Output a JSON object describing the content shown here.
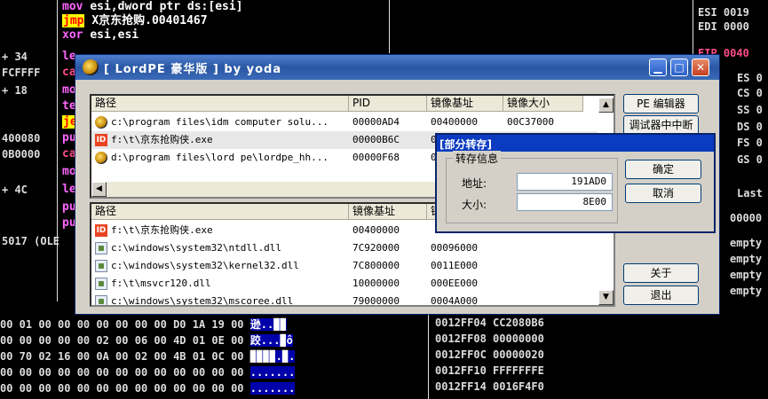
{
  "debugger": {
    "asm_lines": [
      {
        "mnemonic": "mov",
        "operand": "esi,dword ptr ds:[esi]"
      },
      {
        "mnemonic": "jmp",
        "operand": "X京东抢购.00401467"
      },
      {
        "mnemonic": "xor",
        "operand": "esi,esi"
      }
    ],
    "asm_partial_left": [
      "le",
      "ca",
      "mo",
      "te",
      "je",
      "pu",
      "ca",
      "mo",
      "le",
      "pu",
      "pu"
    ],
    "left_values": [
      "+ 34",
      "FCFFFF",
      "+ 18",
      "",
      "",
      "400080",
      "0B0000",
      "",
      "+ 4C",
      "",
      "",
      "5017 (OLE"
    ],
    "registers": [
      {
        "text": "ESI 0019"
      },
      {
        "text": "EDI 0000"
      },
      {
        "text": "EIP 0040"
      },
      {
        "text": "ES 0"
      },
      {
        "text": "CS 0"
      },
      {
        "text": "SS 0"
      },
      {
        "text": "DS 0"
      },
      {
        "text": "FS 0"
      },
      {
        "text": "GS 0"
      },
      {
        "text": "Last"
      },
      {
        "text": "00000"
      },
      {
        "text": "empty"
      },
      {
        "text": "empty"
      },
      {
        "text": "empty"
      },
      {
        "text": "empty"
      }
    ],
    "hex_rows": [
      {
        "bytes": "00 01 00 00 00 00 00 00 00 D0 1A 19 00",
        "ascii": "逊..▉▉"
      },
      {
        "bytes": "00 00 00 00 00 02 00 06 00 4D 01 0E 00",
        "ascii": "跤...▉ô"
      },
      {
        "bytes": "00 70 02 16 00 0A 00 02 00 4B 01 0C 00",
        "ascii": "▉▉▉▉.▉."
      },
      {
        "bytes": "00 00 00 00 00 00 00 00 00 00 00 00 00",
        "ascii": "......."
      },
      {
        "bytes": "00 00 00 00 00 00 00 00 00 00 00 00 00",
        "ascii": "......."
      }
    ],
    "stack_rows": [
      {
        "addr": "0012FF04",
        "val": "CC2080B6"
      },
      {
        "addr": "0012FF08",
        "val": "00000000"
      },
      {
        "addr": "0012FF0C",
        "val": "00000020"
      },
      {
        "addr": "0012FF10",
        "val": "FFFFFFFE"
      },
      {
        "addr": "0012FF14",
        "val": "0016F4F0"
      }
    ]
  },
  "lordpe": {
    "title": "[ LordPE 豪华版 ] by yoda",
    "process_headers": [
      "路径",
      "PID",
      "镜像基址",
      "镜像大小"
    ],
    "processes": [
      {
        "icon": "disk-icon",
        "path": "c:\\program files\\idm computer solu...",
        "pid": "00000AD4",
        "base": "00400000",
        "size": "00C37000"
      },
      {
        "icon": "id-icon",
        "path": "f:\\t\\京东抢购侠.exe",
        "pid": "00000B6C",
        "base": "00400000",
        "size": ""
      },
      {
        "icon": "disk-icon",
        "path": "d:\\program files\\lord pe\\lordpe_hh...",
        "pid": "00000F68",
        "base": "00400000",
        "size": ""
      }
    ],
    "module_headers": [
      "路径",
      "镜像基址",
      "镜"
    ],
    "modules": [
      {
        "icon": "id-icon",
        "path": "f:\\t\\京东抢购侠.exe",
        "base": "00400000",
        "size": ""
      },
      {
        "icon": "dll-icon",
        "path": "c:\\windows\\system32\\ntdll.dll",
        "base": "7C920000",
        "size": "00096000"
      },
      {
        "icon": "dll-icon",
        "path": "c:\\windows\\system32\\kernel32.dll",
        "base": "7C800000",
        "size": "0011E000"
      },
      {
        "icon": "dll-icon",
        "path": "f:\\t\\msvcr120.dll",
        "base": "10000000",
        "size": "000EE000"
      },
      {
        "icon": "dll-icon",
        "path": "c:\\windows\\system32\\mscoree.dll",
        "base": "79000000",
        "size": "0004A000"
      }
    ],
    "buttons": {
      "pe_editor": "PE 编辑器",
      "debugger_break": "调试器中中断",
      "about": "关于",
      "exit": "退出"
    }
  },
  "dump_dialog": {
    "title": "[部分转存]",
    "group": "转存信息",
    "address_label": "地址:",
    "address_value": "191AD0",
    "size_label": "大小:",
    "size_value": "8E00",
    "ok": "确定",
    "cancel": "取消"
  },
  "colors": {
    "title_blue": "#2957a3",
    "dialog_blue": "#0a3bc0",
    "jmp_highlight": "#ffff00",
    "asm_mnemonic": "#ff66ff"
  }
}
